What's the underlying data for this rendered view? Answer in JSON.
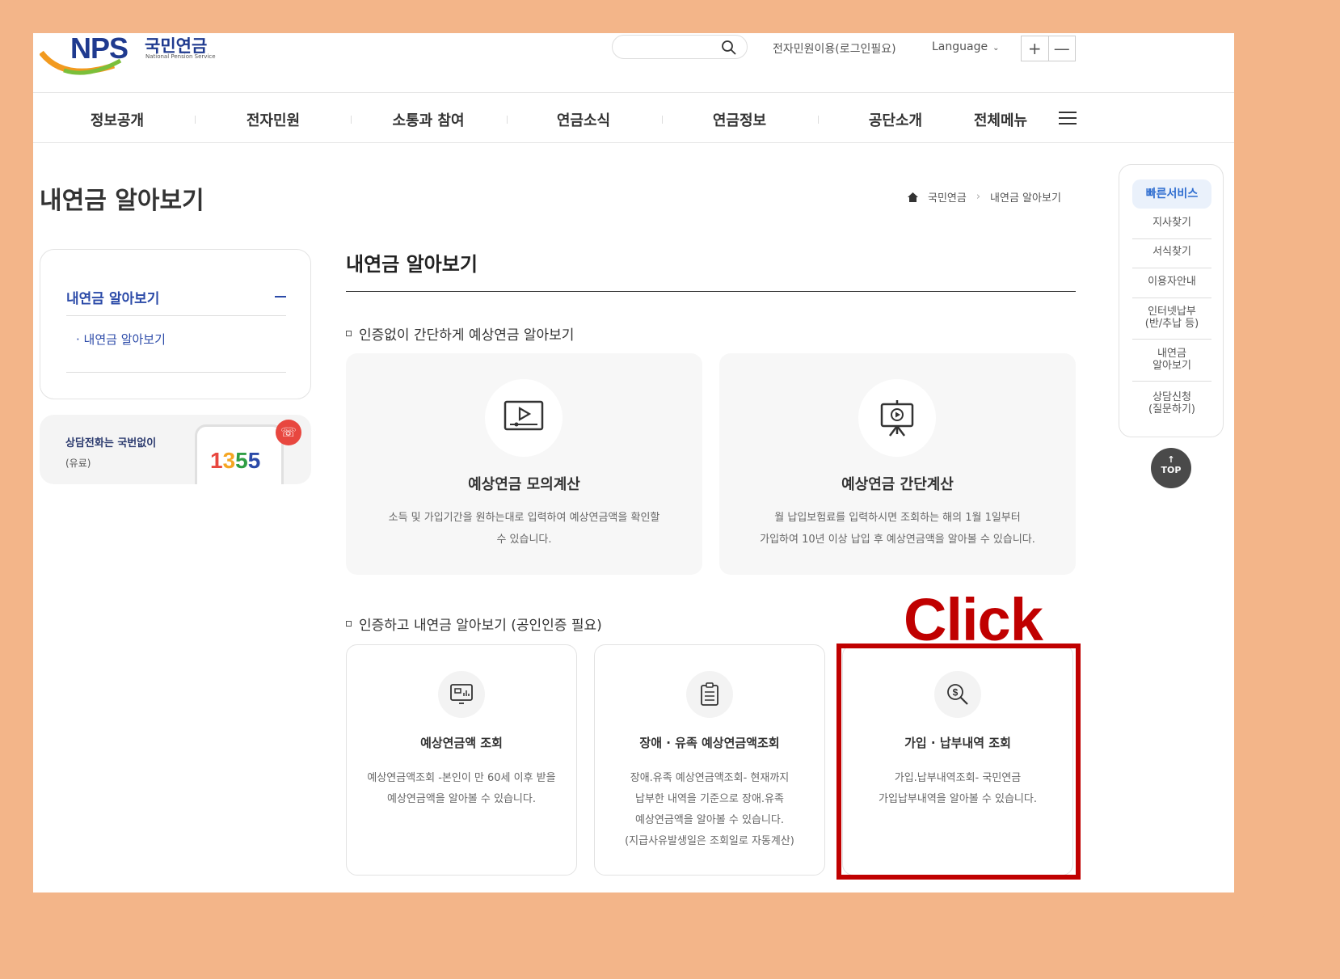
{
  "header": {
    "logo_brand": "NPS",
    "logo_korean": "국민연금",
    "logo_english": "National Pension Service",
    "search_placeholder": "",
    "login_link": "전자민원이용(로그인필요)",
    "language": "Language",
    "zoom_in": "+",
    "zoom_out": "—"
  },
  "gnb": {
    "items": [
      "정보공개",
      "전자민원",
      "소통과 참여",
      "연금소식",
      "연금정보",
      "공단소개"
    ],
    "all_menu": "전체메뉴"
  },
  "page": {
    "title": "내연금 알아보기",
    "breadcrumb": [
      "국민연금",
      "내연금 알아보기"
    ]
  },
  "lnb": {
    "head": "내연금 알아보기",
    "sub_items": [
      "· 내연금 알아보기"
    ]
  },
  "callbox": {
    "line1": "상담전화는 국번없이",
    "line2": "(유료)",
    "number": "1355"
  },
  "content": {
    "title": "내연금 알아보기",
    "section1": "인증없이 간단하게 예상연금 알아보기",
    "section2": "인증하고 내연금 알아보기 (공인인증 필요)",
    "big_cards": [
      {
        "title": "예상연금 모의계산",
        "desc1": "소득 및 가입기간을 원하는대로 입력하여 예상연금액을 확인할",
        "desc2": "수 있습니다."
      },
      {
        "title": "예상연금 간단계산",
        "desc1": "월 납입보험료를 입력하시면 조회하는 해의 1월 1일부터",
        "desc2": "가입하여 10년 이상 납입 후 예상연금액을 알아볼 수 있습니다."
      }
    ],
    "small_cards": [
      {
        "title": "예상연금액 조회",
        "lines": [
          "예상연금액조회 -본인이 만 60세 이후 받을",
          "예상연금액을 알아볼 수 있습니다."
        ]
      },
      {
        "title": "장애 · 유족 예상연금액조회",
        "lines": [
          "장애.유족 예상연금액조회- 현재까지",
          "납부한 내역을 기준으로 장애.유족",
          "예상연금액을 알아볼 수 있습니다.",
          "(지급사유발생일은 조회일로 자동계산)"
        ]
      },
      {
        "title": "가입 · 납부내역 조회",
        "lines": [
          "가입.납부내역조회- 국민연금",
          "가입납부내역을 알아볼 수 있습니다."
        ]
      }
    ]
  },
  "quick": {
    "head": "빠른서비스",
    "items": [
      "지사찾기",
      "서식찾기",
      "이용자안내",
      "인터넷납부\n(반/추납 등)",
      "내연금\n알아보기",
      "상담신청\n(질문하기)"
    ],
    "top_arrow": "↑",
    "top_label": "TOP"
  },
  "annotation": {
    "label": "Click",
    "color": "#c00000"
  },
  "colors": {
    "frame": "#f3b589",
    "brand_blue": "#1f3a8f",
    "link_blue": "#2b4aa8"
  },
  "phone_digits_colors": [
    "#e8473f",
    "#f5a623",
    "#2f9e44",
    "#2b4aa8"
  ]
}
